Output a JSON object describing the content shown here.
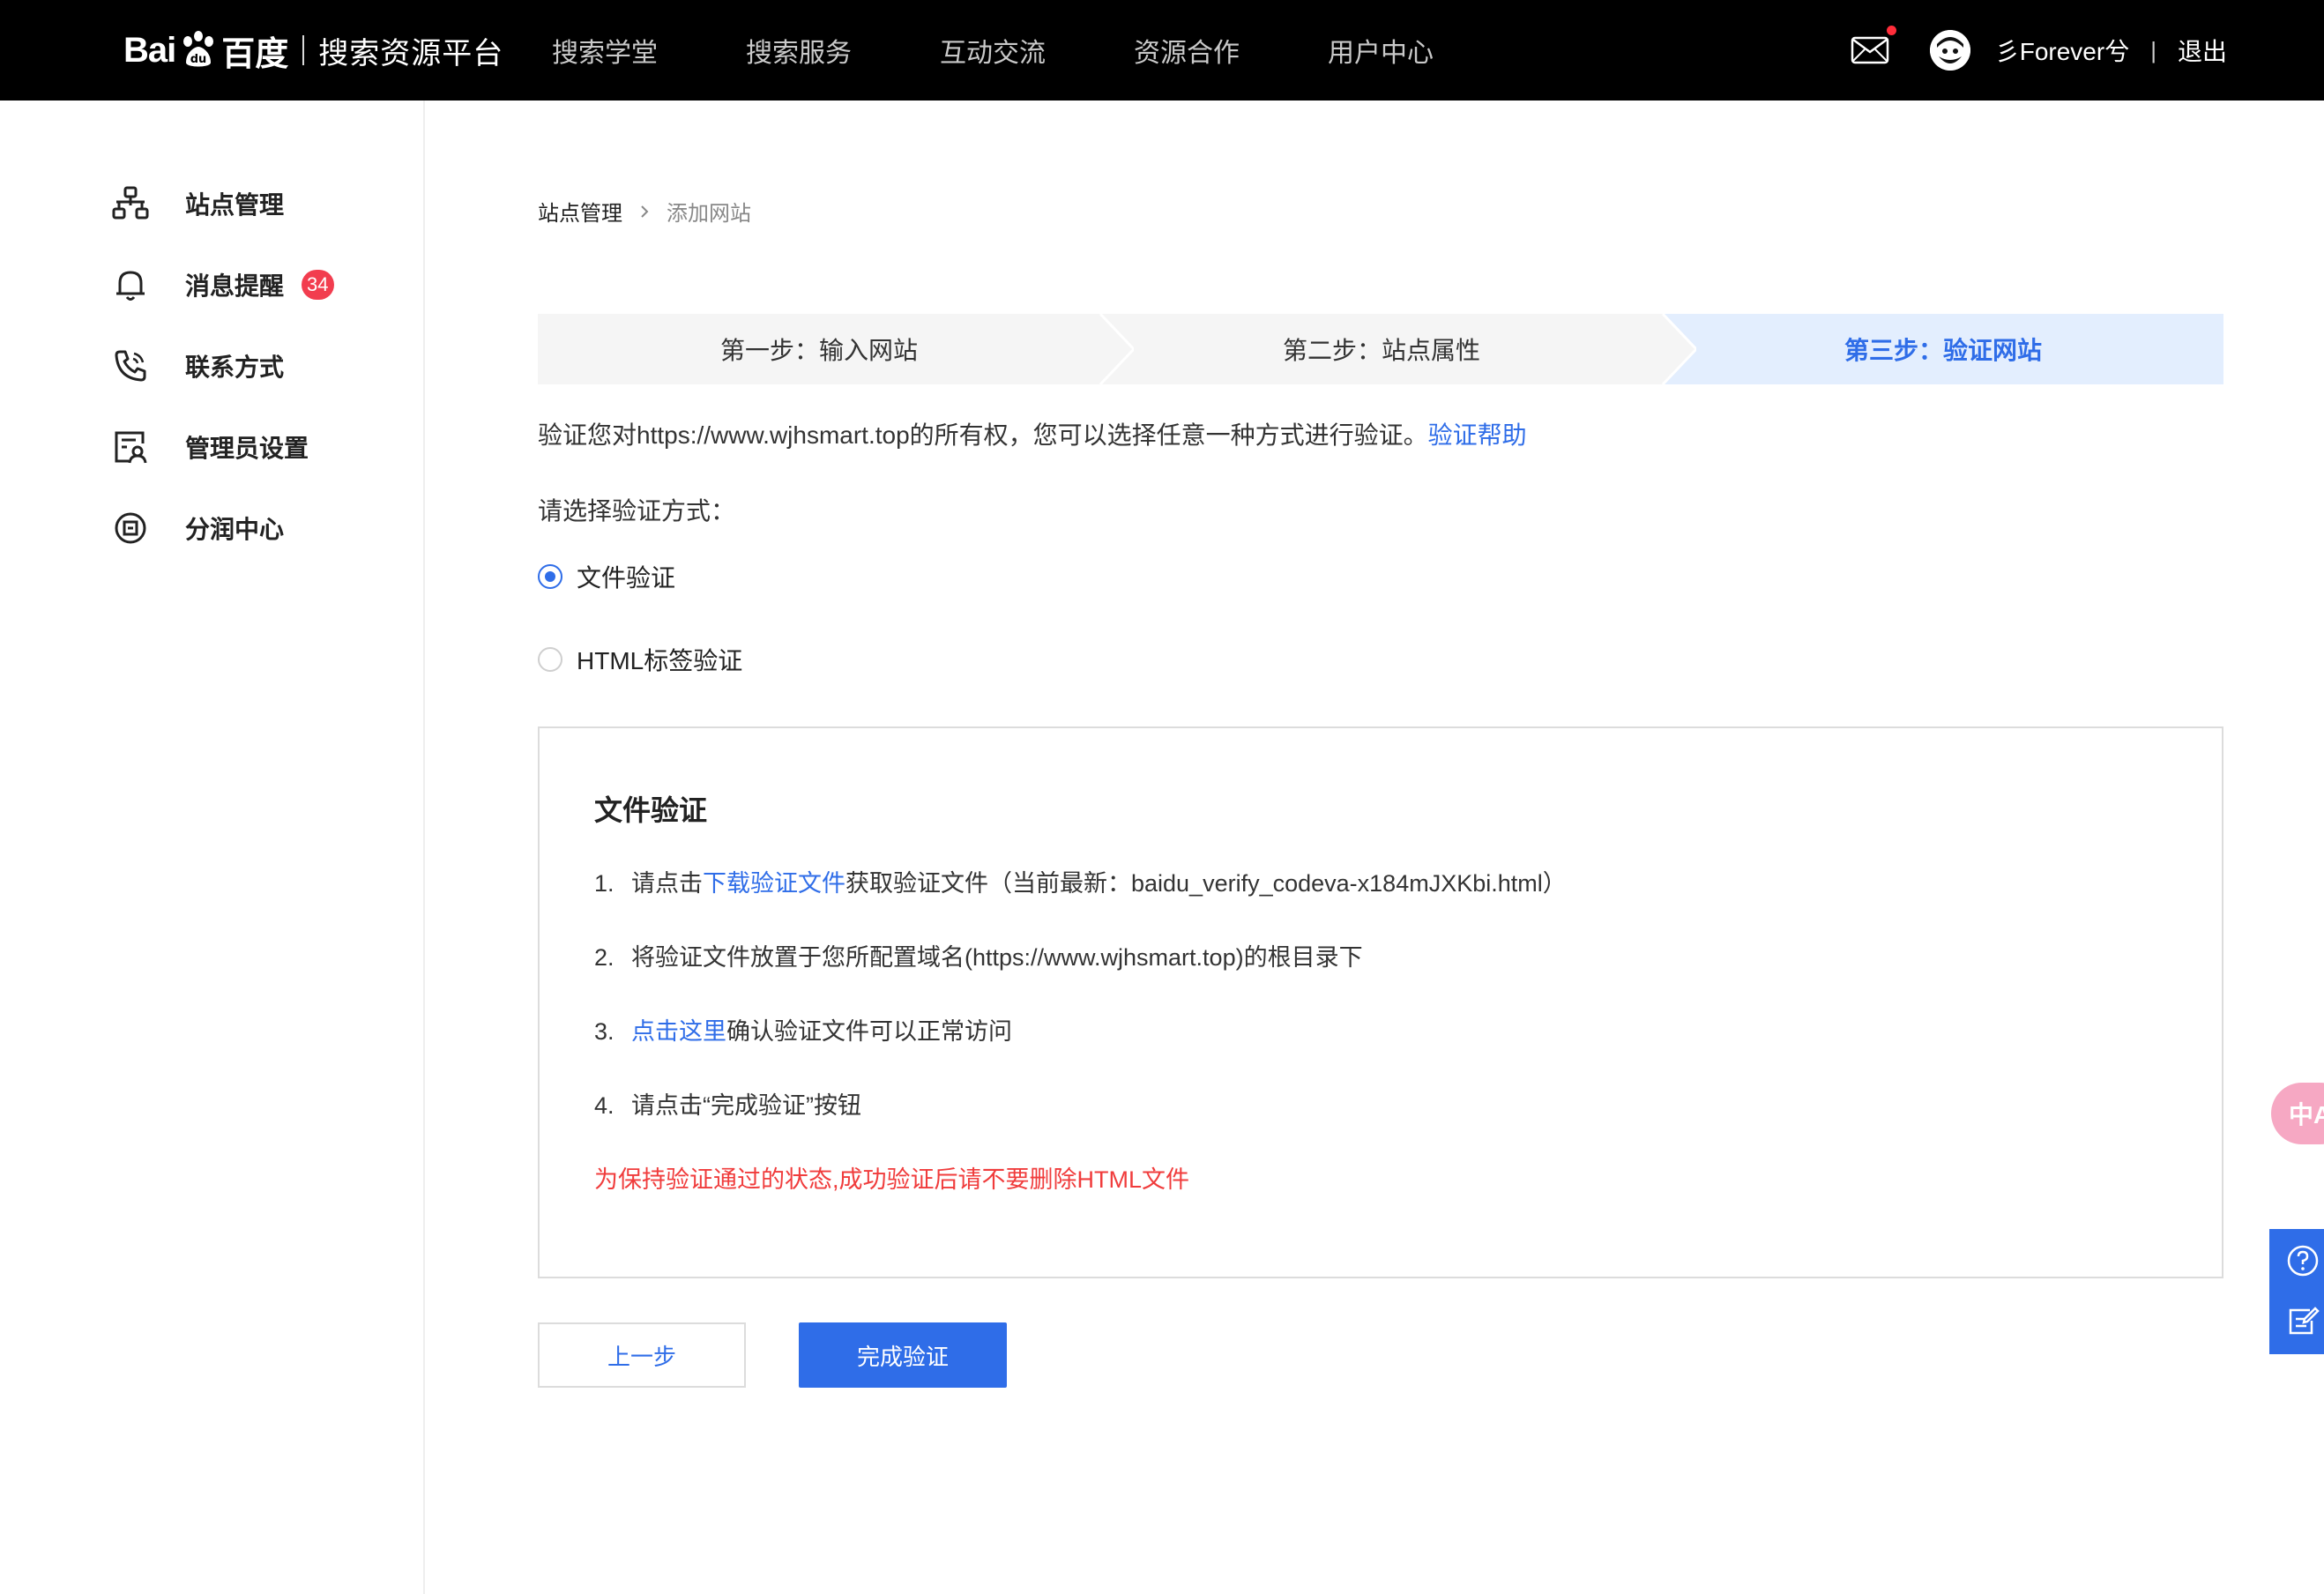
{
  "header": {
    "logo_en": "Bai",
    "logo_cn": "百度",
    "platform_title": "搜索资源平台",
    "nav": [
      "搜索学堂",
      "搜索服务",
      "互动交流",
      "资源合作",
      "用户中心"
    ],
    "username": "彡Forever兮",
    "separator": "|",
    "logout": "退出"
  },
  "sidebar": {
    "items": [
      {
        "label": "站点管理",
        "icon": "sitemap-icon"
      },
      {
        "label": "消息提醒",
        "icon": "bell-icon",
        "badge": "34"
      },
      {
        "label": "联系方式",
        "icon": "phone-icon"
      },
      {
        "label": "管理员设置",
        "icon": "admin-settings-icon"
      },
      {
        "label": "分润中心",
        "icon": "revenue-icon"
      }
    ]
  },
  "breadcrumb": {
    "parent": "站点管理",
    "current": "添加网站"
  },
  "steps": [
    "第一步：输入网站",
    "第二步：站点属性",
    "第三步：验证网站"
  ],
  "intro": {
    "text": "验证您对https://www.wjhsmart.top的所有权，您可以选择任意一种方式进行验证。",
    "help_link": "验证帮助"
  },
  "choose_label": "请选择验证方式：",
  "options": [
    {
      "label": "文件验证",
      "checked": true
    },
    {
      "label": "HTML标签验证",
      "checked": false
    }
  ],
  "panel": {
    "title": "文件验证",
    "step1": {
      "num": "1.",
      "prefix": "请点击",
      "link": "下载验证文件",
      "suffix": "获取验证文件（当前最新：baidu_verify_codeva-x184mJXKbi.html）"
    },
    "step2": {
      "num": "2.",
      "text": "将验证文件放置于您所配置域名(https://www.wjhsmart.top)的根目录下"
    },
    "step3": {
      "num": "3.",
      "link": "点击这里",
      "suffix": "确认验证文件可以正常访问"
    },
    "step4": {
      "num": "4.",
      "text": "请点击“完成验证”按钮"
    },
    "warning": "为保持验证通过的状态,成功验证后请不要删除HTML文件"
  },
  "buttons": {
    "prev": "上一步",
    "done": "完成验证"
  },
  "floating": {
    "translate": "中A"
  },
  "colors": {
    "accent": "#2f6de8",
    "badge": "#f23d4f",
    "warning": "#f03c3c",
    "topbar": "#000000"
  }
}
